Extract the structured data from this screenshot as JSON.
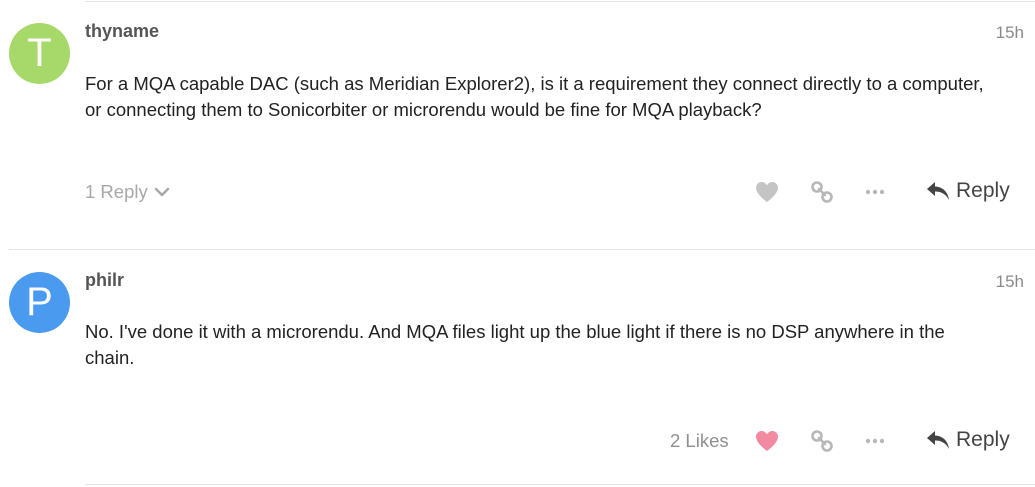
{
  "posts": [
    {
      "avatar_letter": "T",
      "avatar_color": "#a6d96a",
      "username": "thyname",
      "date": "15h",
      "body_lines": [
        "For a MQA capable DAC (such as Meridian Explorer2), is it a requirement they connect directly to a computer,",
        "or connecting them to Sonicorbiter or microrendu would be fine for MQA playback?"
      ],
      "replies_label": "1 Reply",
      "reply_label": "Reply"
    },
    {
      "avatar_letter": "P",
      "avatar_color": "#4a9af0",
      "username": "philr",
      "date": "15h",
      "body_lines": [
        "No. I've done it with a microrendu. And MQA files light up the blue light if there is no DSP anywhere in the",
        "chain."
      ],
      "likes_label": "2 Likes",
      "reply_label": "Reply"
    }
  ],
  "colors": {
    "like_inactive": "#c4c4c4",
    "like_active": "#f28ba2",
    "icon_gray": "#b8b8b8",
    "reply_dark": "#444444"
  },
  "icons": {
    "like": "heart-icon",
    "share": "link-icon",
    "more": "ellipsis-icon",
    "reply": "reply-arrow-icon",
    "expand": "chevron-down-icon"
  }
}
